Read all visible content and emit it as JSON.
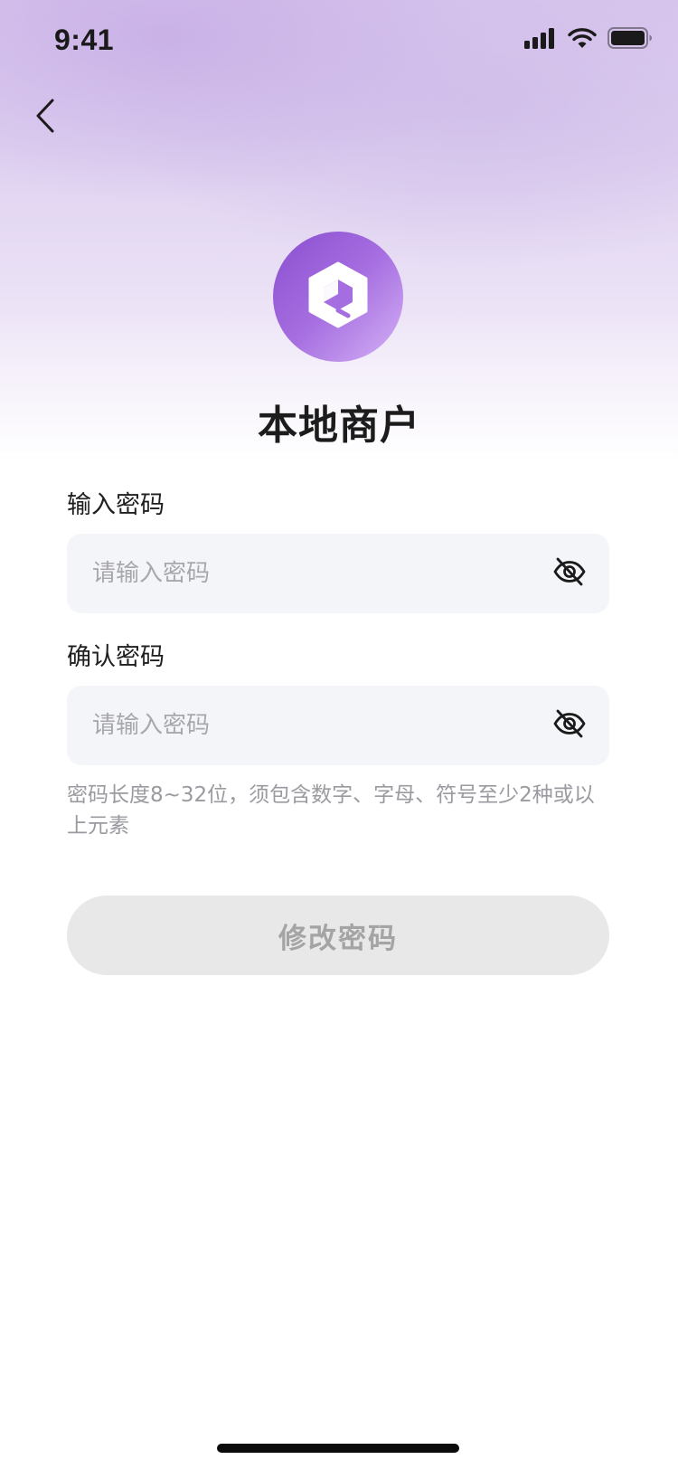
{
  "status_bar": {
    "time": "9:41",
    "icons": [
      "cellular-signal-icon",
      "wifi-icon",
      "battery-icon"
    ]
  },
  "navigation": {
    "back_icon": "chevron-left-icon"
  },
  "brand": {
    "logo_icon": "hexagon-cube-logo",
    "title": "本地商户",
    "gradient_colors": [
      "#8a4fd0",
      "#d4b2f6"
    ]
  },
  "form": {
    "password": {
      "label": "输入密码",
      "placeholder": "请输入密码",
      "value": "",
      "toggle_icon": "eye-slash-icon"
    },
    "confirm_password": {
      "label": "确认密码",
      "placeholder": "请输入密码",
      "value": "",
      "toggle_icon": "eye-slash-icon"
    },
    "hint": "密码长度8~32位，须包含数字、字母、符号至少2种或以上元素",
    "submit_label": "修改密码"
  },
  "colors": {
    "background_top": "#d9c6ee",
    "input_bg": "#f4f5f9",
    "button_disabled_bg": "#e8e8e8",
    "button_disabled_text": "#a4a4a4",
    "hint_text": "#9a9aa0"
  }
}
